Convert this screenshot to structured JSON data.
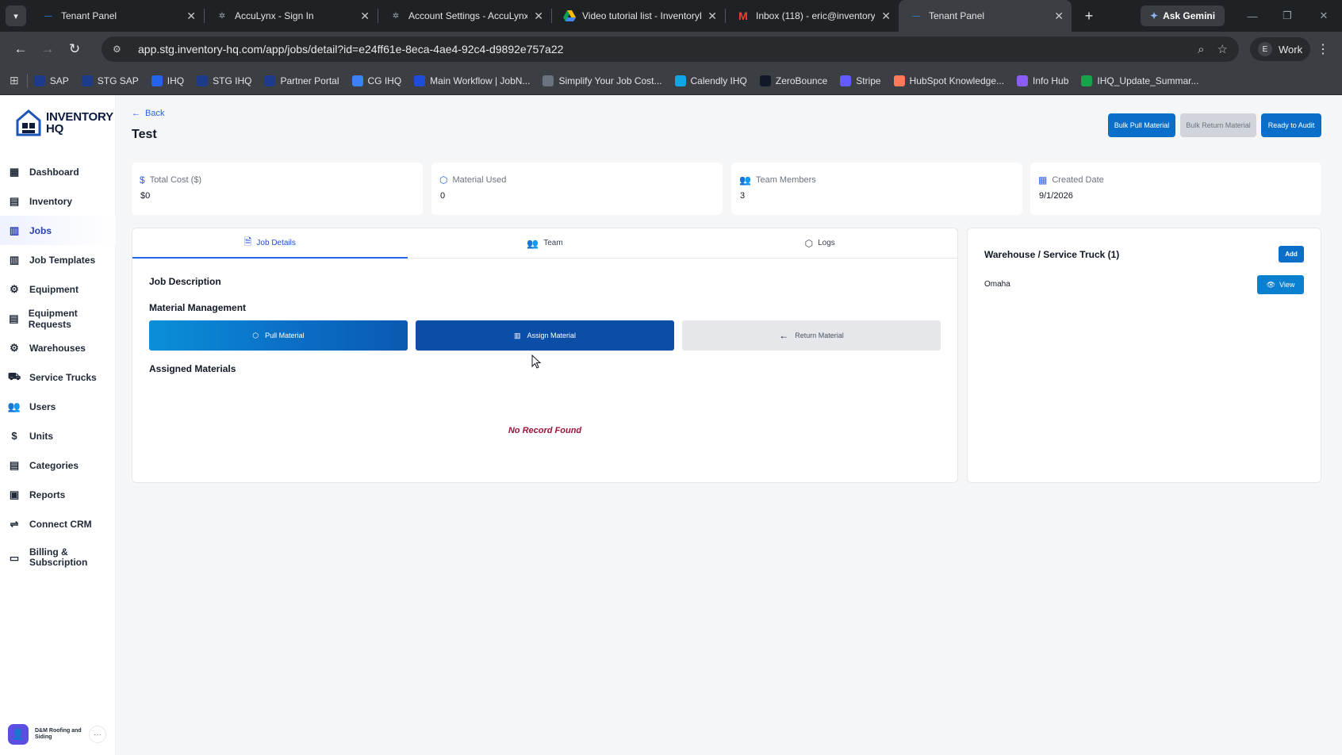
{
  "browser": {
    "tabs": [
      {
        "title": "Tenant Panel",
        "favicon": "dash-favicon",
        "color": "#3b82f6"
      },
      {
        "title": "AccuLynx - Sign In",
        "favicon": "acculynx-favicon",
        "color": "#9ca3af"
      },
      {
        "title": "Account Settings - AccuLynx",
        "favicon": "acculynx-favicon",
        "color": "#9ca3af"
      },
      {
        "title": "Video tutorial list - InventoryH",
        "favicon": "drive-favicon",
        "color": "#fbbc04"
      },
      {
        "title": "Inbox (118) - eric@inventory-h",
        "favicon": "gmail-favicon",
        "color": "#ea4335"
      },
      {
        "title": "Tenant Panel",
        "favicon": "dash-favicon",
        "color": "#3b82f6"
      }
    ],
    "gemini_label": "Ask Gemini",
    "url": "app.stg.inventory-hq.com/app/jobs/detail?id=e24ff61e-8eca-4ae4-92c4-d9892e757a22",
    "profile_initial": "E",
    "profile_label": "Work",
    "bookmarks": [
      {
        "label": "SAP",
        "color": "#1e3a8a"
      },
      {
        "label": "STG SAP",
        "color": "#1e3a8a"
      },
      {
        "label": "IHQ",
        "color": "#2563eb"
      },
      {
        "label": "STG IHQ",
        "color": "#1e3a8a"
      },
      {
        "label": "Partner Portal",
        "color": "#1e3a8a"
      },
      {
        "label": "CG IHQ",
        "color": "#3b82f6"
      },
      {
        "label": "Main Workflow | JobN...",
        "color": "#1d4ed8"
      },
      {
        "label": "Simplify Your Job Cost...",
        "color": "#6b7280"
      },
      {
        "label": "Calendly IHQ",
        "color": "#0ea5e9"
      },
      {
        "label": "ZeroBounce",
        "color": "#111827"
      },
      {
        "label": "Stripe",
        "color": "#635bff"
      },
      {
        "label": "HubSpot Knowledge...",
        "color": "#ff7a59"
      },
      {
        "label": "Info Hub",
        "color": "#8b5cf6"
      },
      {
        "label": "IHQ_Update_Summar...",
        "color": "#16a34a"
      }
    ]
  },
  "brand": {
    "line1": "INVENTORY",
    "line2": "HQ"
  },
  "sidebar": {
    "items": [
      {
        "label": "Dashboard",
        "icon": "grid-icon"
      },
      {
        "label": "Inventory",
        "icon": "boxes-icon"
      },
      {
        "label": "Jobs",
        "icon": "briefcase-icon"
      },
      {
        "label": "Job Templates",
        "icon": "template-icon"
      },
      {
        "label": "Equipment",
        "icon": "wrench-icon"
      },
      {
        "label": "Equipment Requests",
        "icon": "list-icon"
      },
      {
        "label": "Warehouses",
        "icon": "warehouse-icon"
      },
      {
        "label": "Service Trucks",
        "icon": "truck-icon"
      },
      {
        "label": "Users",
        "icon": "users-icon"
      },
      {
        "label": "Units",
        "icon": "units-icon"
      },
      {
        "label": "Categories",
        "icon": "categories-icon"
      },
      {
        "label": "Reports",
        "icon": "reports-icon"
      },
      {
        "label": "Connect CRM",
        "icon": "connect-icon"
      },
      {
        "label": "Billing & Subscription",
        "icon": "card-icon"
      }
    ],
    "active_index": 2,
    "org_name": "D&M Roofing and Siding"
  },
  "header": {
    "back_label": "Back",
    "title": "Test",
    "buttons": {
      "bulk_pull": "Bulk Pull Material",
      "bulk_return": "Bulk Return Material",
      "ready_audit": "Ready to Audit"
    }
  },
  "stats": [
    {
      "label": "Total Cost ($)",
      "value": "$0",
      "icon": "dollar-icon"
    },
    {
      "label": "Material Used",
      "value": "0",
      "icon": "package-icon"
    },
    {
      "label": "Team Members",
      "value": "3",
      "icon": "team-icon"
    },
    {
      "label": "Created Date",
      "value": "9/1/2026",
      "icon": "calendar-icon"
    }
  ],
  "detail_tabs": [
    {
      "label": "Job Details",
      "icon": "document-icon"
    },
    {
      "label": "Team",
      "icon": "users-icon"
    },
    {
      "label": "Logs",
      "icon": "box-icon"
    }
  ],
  "details": {
    "job_description_title": "Job Description",
    "material_management_title": "Material Management",
    "pull_label": "Pull Material",
    "assign_label": "Assign Material",
    "return_label": "Return Material",
    "assigned_title": "Assigned Materials",
    "empty_label": "No Record Found"
  },
  "warehouse": {
    "title": "Warehouse / Service Truck (1)",
    "add_label": "Add",
    "items": [
      {
        "name": "Omaha",
        "view_label": "View"
      }
    ]
  }
}
